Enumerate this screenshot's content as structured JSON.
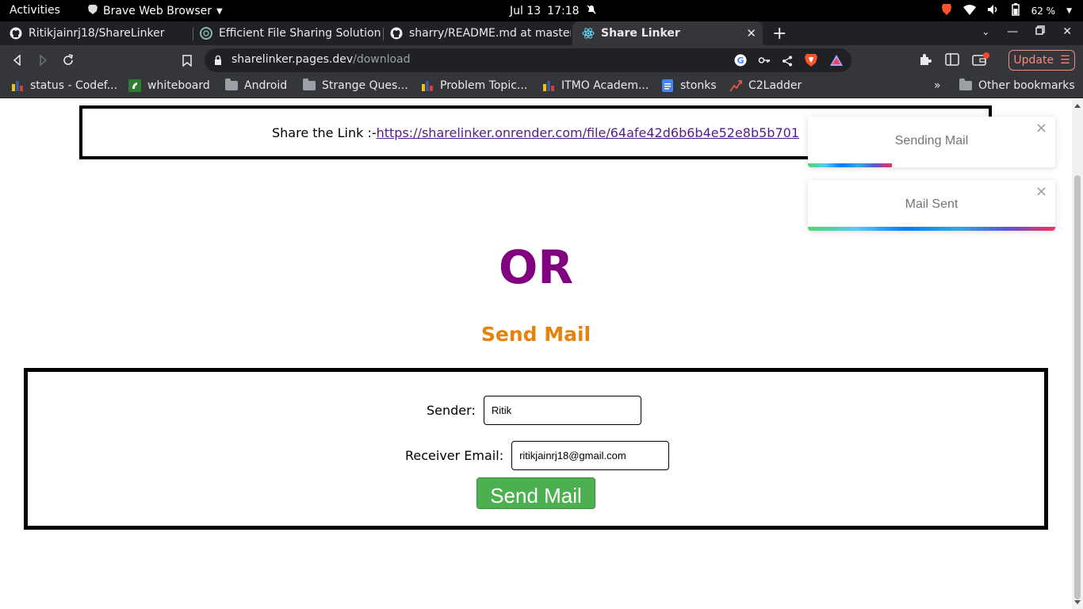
{
  "system_bar": {
    "activities": "Activities",
    "app_name": "Brave Web Browser",
    "date": "Jul 13",
    "time": "17:18",
    "battery": "62 %"
  },
  "tabs": [
    {
      "title": "Ritikjainrj18/ShareLinker",
      "icon": "github-icon"
    },
    {
      "title": "Efficient File Sharing Solution",
      "icon": "chatgpt-icon"
    },
    {
      "title": "sharry/README.md at master",
      "icon": "github-icon"
    },
    {
      "title": "Share Linker",
      "icon": "react-icon",
      "active": true
    }
  ],
  "address_bar": {
    "domain": "sharelinker.pages.dev",
    "path": "/download"
  },
  "update_button": "Update",
  "bookmarks": [
    {
      "label": "status - Codef...",
      "icon": "codeforces-icon"
    },
    {
      "label": "whiteboard",
      "icon": "whiteboard-icon"
    },
    {
      "label": "Android",
      "icon": "folder-icon"
    },
    {
      "label": "Strange Ques...",
      "icon": "folder-icon"
    },
    {
      "label": "Problem Topic...",
      "icon": "codeforces-icon"
    },
    {
      "label": "ITMO Academ...",
      "icon": "codeforces-icon"
    },
    {
      "label": "stonks",
      "icon": "docs-icon"
    },
    {
      "label": "C2Ladder",
      "icon": "ladder-icon"
    }
  ],
  "other_bookmarks": "Other bookmarks",
  "page": {
    "share_prefix": "Share the Link :-",
    "share_link": "https://sharelinker.onrender.com/file/64afe42d6b6b4e52e8b5b701",
    "or_text": "OR",
    "send_mail_heading": "Send Mail",
    "form": {
      "sender_label": "Sender:",
      "sender_value": "Ritik",
      "receiver_label": "Receiver Email:",
      "receiver_value": "ritikjainrj18@gmail.com",
      "submit_label": "Send Mail"
    }
  },
  "toasts": [
    {
      "message": "Sending Mail",
      "progress": 0.34
    },
    {
      "message": "Mail Sent",
      "progress": 1.0
    }
  ],
  "colors": {
    "or_purple": "#800080",
    "heading_orange": "#e8820c",
    "button_green": "#4caf50",
    "link_purple": "#551a8b"
  }
}
